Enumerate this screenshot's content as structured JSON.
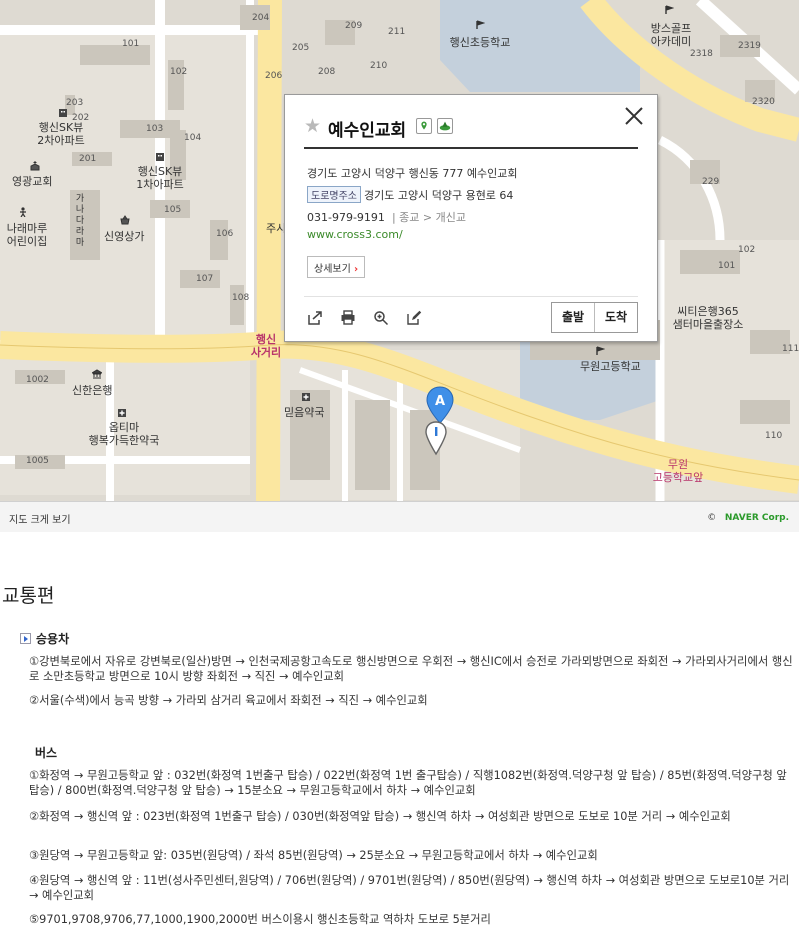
{
  "map": {
    "labels": {
      "school_top": "행신초등학교",
      "bangs_golf": "방스골프\n아카데미",
      "sk_view2": "행신SK뷰\n2차아파트",
      "sk_view1": "행신SK뷰\n1차아파트",
      "younggwang": "영광교회",
      "naraemaru": "나래마루\n어린이집",
      "sinyoung": "신영상가",
      "ju": "주시",
      "citibank": "씨티은행365\n샘터마을출장소",
      "muwon_high": "무원고등학교",
      "haengsin_junction": "행신\n사거리",
      "shinhan": "신한은행",
      "optima": "옵티마\n행복가득한약국",
      "mideum": "믿음약국",
      "muwon_stop": "무원\n고등학교앞",
      "ganada": "가\n나\n다\n라\n마"
    },
    "numbers": [
      "204",
      "209",
      "211",
      "205",
      "208",
      "210",
      "206",
      "101",
      "102",
      "203",
      "103",
      "201",
      "104",
      "202",
      "105",
      "106",
      "107",
      "108",
      "2318",
      "2319",
      "2320",
      "229",
      "101",
      "102",
      "111",
      "110",
      "1002",
      "1005"
    ],
    "marker_a": "A",
    "footer_big": "지도 크게 보기",
    "footer_copy_prefix": "©",
    "footer_copy": "NAVER Corp."
  },
  "popup": {
    "title": "예수인교회",
    "address": "경기도 고양시 덕양구 행신동 777 예수인교회",
    "road_tag": "도로명주소",
    "road_address": "경기도 고양시 덕양구 용현로 64",
    "phone": "031-979-9191",
    "category": "| 종교 > 개신교",
    "url": "www.cross3.com/",
    "detail_label": "상세보기",
    "depart_label": "출발",
    "arrive_label": "도착"
  },
  "transport": {
    "title": "교통편",
    "car_heading": "승용차",
    "car_items": [
      "①강변북로에서 자유로 강변북로(일산)방면 → 인천국제공항고속도로 행신방면으로 우회전 → 행신IC에서 승전로 가라뫼방면으로 좌회전 → 가라뫼사거리에서 행신로 소만초등학교 방면으로 10시 방향 좌회전 → 직진 → 예수인교회",
      "②서울(수색)에서 능곡 방향 → 가라뫼 삼거리 육교에서 좌회전 → 직진 → 예수인교회"
    ],
    "bus_heading": "버스",
    "bus_items": [
      "①화정역 → 무원고등학교 앞 : 032번(화정역 1번출구 탑승) / 022번(화정역 1번 출구탑승) / 직행1082번(화정역.덕양구청 앞 탑승) / 85번(화정역.덕양구청 앞 탑승) / 800번(화정역.덕양구청 앞 탑승) → 15분소요 → 무원고등학교에서 하차 → 예수인교회",
      "②화정역 → 행신역 앞 : 023번(화정역 1번출구 탑승) / 030번(화정역앞 탑승) → 행신역 하차 → 여성회관 방면으로 도보로 10분 거리 → 예수인교회",
      "③원당역 → 무원고등학교 앞: 035번(원당역) / 좌석 85번(원당역) → 25분소요 → 무원고등학교에서 하차 → 예수인교회",
      "④원당역 → 행신역 앞 : 11번(성사주민센터,원당역) / 706번(원당역) / 9701번(원당역) / 850번(원당역) → 행신역 하차 → 여성회관 방면으로 도보로10분 거리 → 예수인교회",
      "⑤9701,9708,9706,77,1000,1900,2000번 버스이용시 행신초등학교 역하차 도보로 5분거리"
    ]
  }
}
